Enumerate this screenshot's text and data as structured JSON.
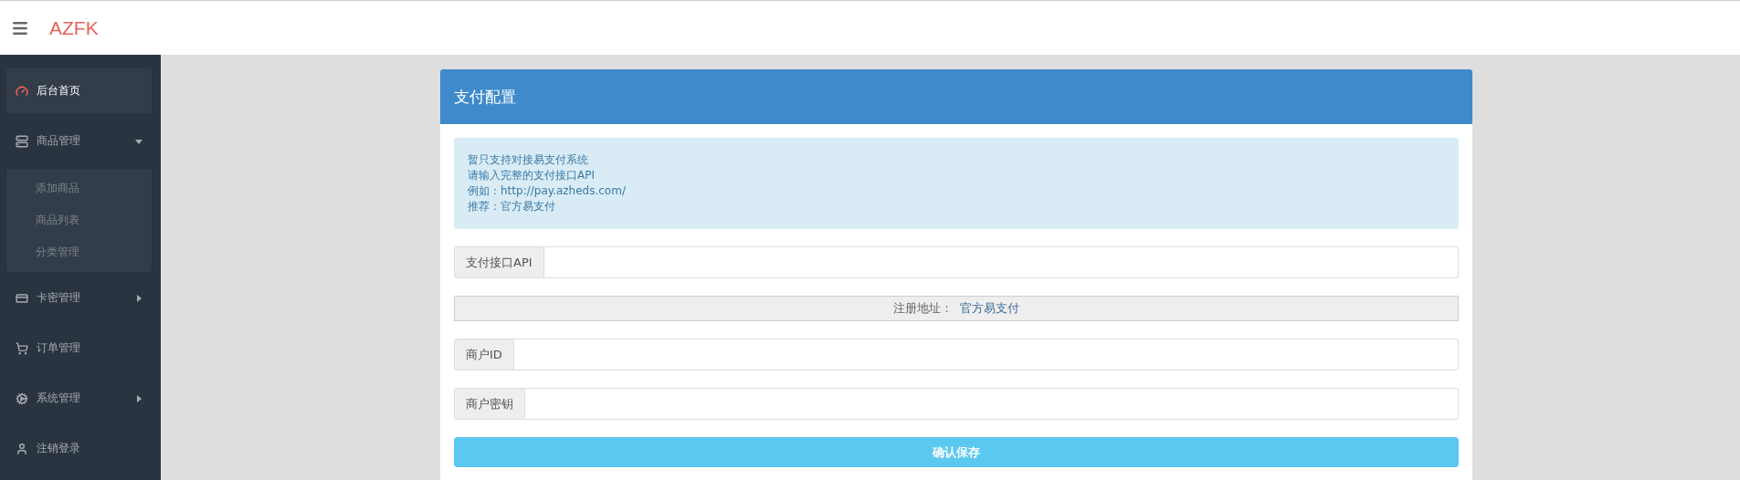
{
  "header": {
    "brand": "AZFK"
  },
  "sidebar": {
    "items": [
      {
        "kind": "link",
        "label": "后台首页",
        "selected": true
      },
      {
        "kind": "group",
        "label": "商品管理",
        "selected": false,
        "expanded": true,
        "children": [
          {
            "label": "添加商品"
          },
          {
            "label": "商品列表"
          },
          {
            "label": "分类管理"
          }
        ]
      },
      {
        "kind": "group",
        "label": "卡密管理",
        "selected": false,
        "expanded": false
      },
      {
        "kind": "link",
        "label": "订单管理",
        "selected": false
      },
      {
        "kind": "group",
        "label": "系统管理",
        "selected": false,
        "expanded": false
      },
      {
        "kind": "link",
        "label": "注销登录",
        "selected": false
      }
    ]
  },
  "panel": {
    "title": "支付配置",
    "notice": [
      "暂只支持对接易支付系统",
      "请输入完整的支付接口API",
      "例如：http://pay.azheds.com/",
      "推荐：官方易支付"
    ],
    "fields": [
      {
        "kind": "input",
        "label": "支付接口API"
      },
      {
        "kind": "link_row",
        "label": "注册地址：",
        "link": "官方易支付"
      },
      {
        "kind": "input",
        "label": "商户ID"
      },
      {
        "kind": "input",
        "label": "商户密钥"
      }
    ],
    "submit": "确认保存"
  }
}
